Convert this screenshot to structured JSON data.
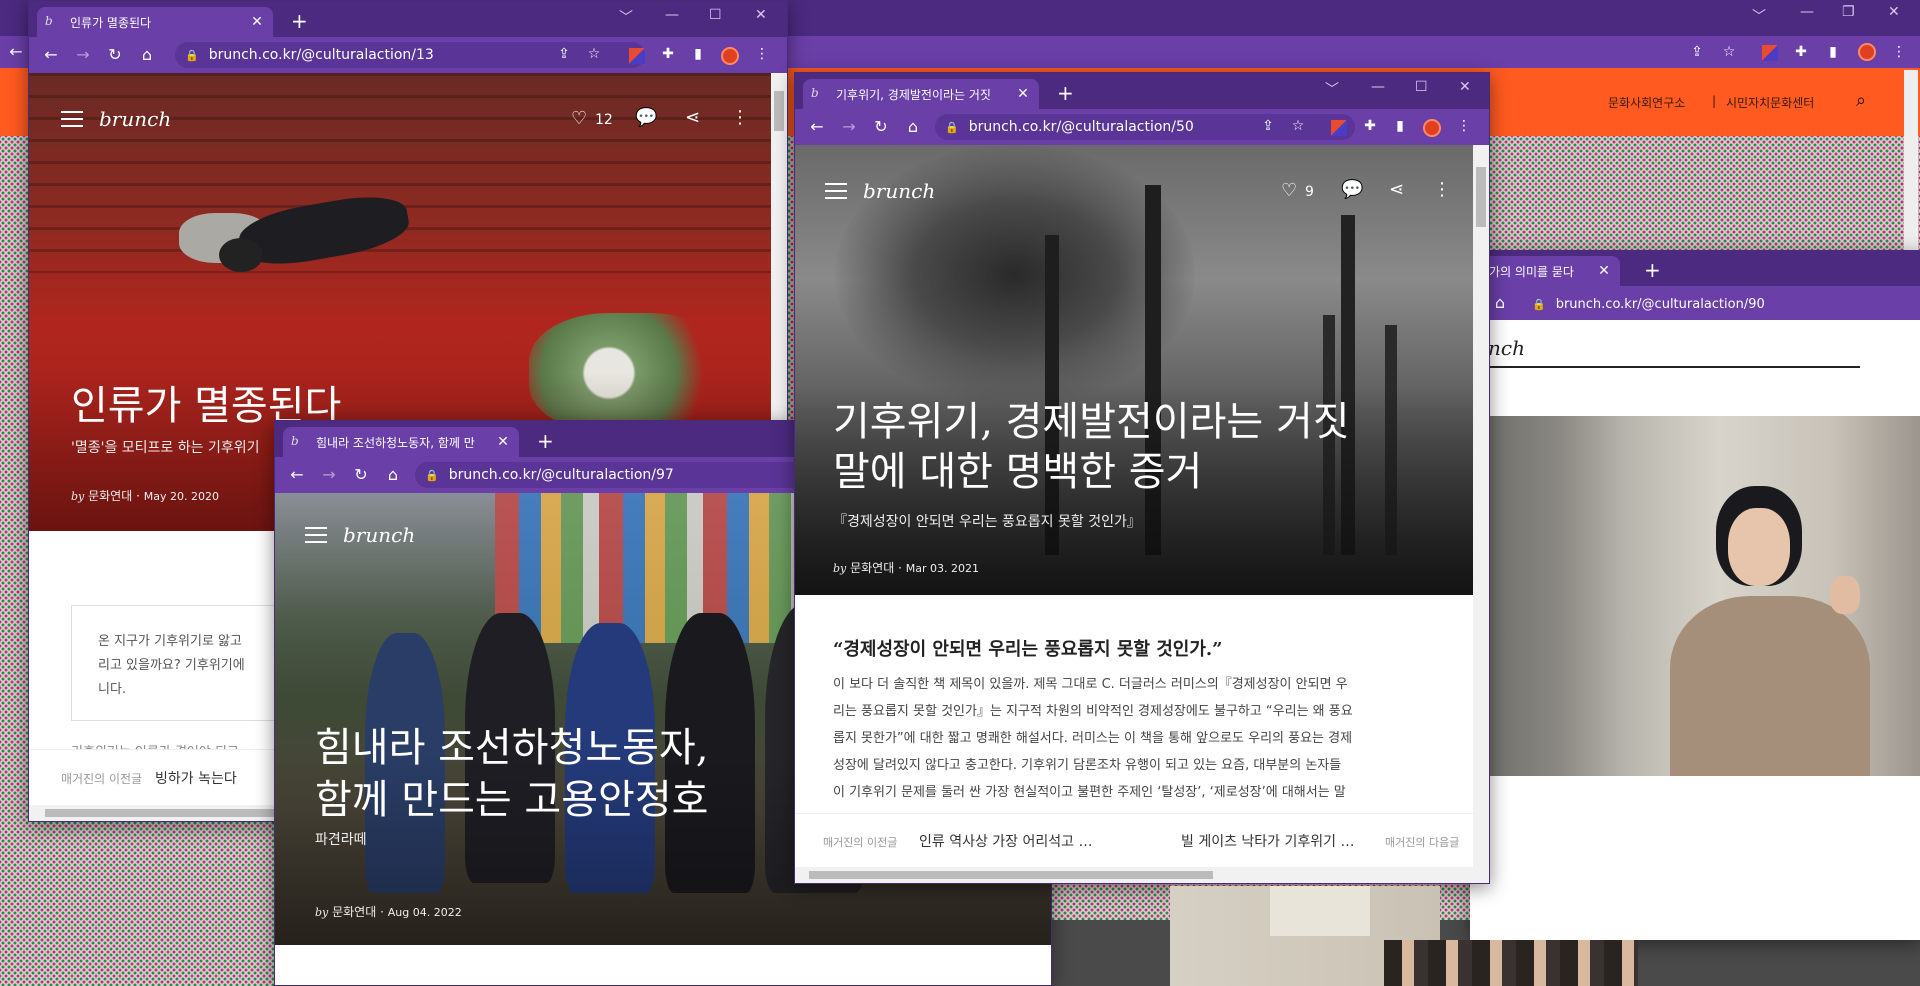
{
  "bg_window": {
    "header_links": [
      "문화사회연구소",
      "|",
      "시민자치문화센터"
    ],
    "search_icon": "search-icon"
  },
  "win_90": {
    "tab_title": "동가의 의미를 묻다",
    "url": "brunch.co.kr/@culturalaction/90",
    "logo": "nch"
  },
  "win_13": {
    "tab_title": "인류가 멸종된다",
    "url": "brunch.co.kr/@culturalaction/13",
    "logo": "brunch",
    "like_count": "12",
    "hero_title": "인류가 멸종된다",
    "subtitle": "'멸종'을 모티프로 하는 기후위기",
    "by": "by",
    "author": "문화연대",
    "date": "May 20. 2020",
    "quote": "온 지구가 기후위기로 앓고\n리고 있을까요? 기후위기에\n니다.",
    "body_fragment": "기후위기는 인류가 겪어야 되고",
    "prev_label": "매거진의 이전글",
    "prev_title": "빙하가 녹는다"
  },
  "win_97": {
    "tab_title": "힘내라 조선하청노동자, 함께 만",
    "url": "brunch.co.kr/@culturalaction/97",
    "logo": "brunch",
    "hero_title_1": "힘내라 조선하청노동자,",
    "hero_title_2": "함께 만드는 고용안정호",
    "subtitle": "파견라떼",
    "by": "by",
    "author": "문화연대",
    "date": "Aug 04. 2022"
  },
  "win_50": {
    "tab_title": "기후위기, 경제발전이라는 거짓",
    "url": "brunch.co.kr/@culturalaction/50",
    "logo": "brunch",
    "like_count": "9",
    "hero_title_1": "기후위기, 경제발전이라는 거짓",
    "hero_title_2": "말에 대한 명백한 증거",
    "subtitle": "『경제성장이 안되면 우리는 풍요롭지 못할 것인가』",
    "by": "by",
    "author": "문화연대",
    "date": "Mar 03. 2021",
    "article_heading": "“경제성장이 안되면 우리는 풍요롭지 못할 것인가.”",
    "article_lines": [
      "이 보다 더 솔직한 책 제목이 있을까. 제목 그대로 C. 더글러스 러미스의『경제성장이 안되면 우",
      "리는 풍요롭지 못할 것인가』는 지구적 차원의 비약적인 경제성장에도 불구하고 “우리는 왜 풍요",
      "롭지 못한가”에 대한 짧고 명쾌한 해설서다. 러미스는 이 책을 통해 앞으로도 우리의 풍요는 경제",
      "성장에 달려있지 않다고 충고한다. 기후위기 담론조차 유행이 되고 있는 요즘, 대부분의 논자들",
      "이 기후위기 문제를 둘러 싼 가장 현실적이고 불편한 주제인 ‘탈성장’, ‘제로성장’에 대해서는 말"
    ],
    "prev_label": "매거진의 이전글",
    "prev_title": "인류 역사상 가장 어리석고 …",
    "next_title": "빌 게이츠 낙타가 기후위기 …",
    "next_label": "매거진의 다음글"
  },
  "colors": {
    "chrome_dark": "#4b2a80",
    "chrome_tab": "#6a3fa8",
    "orange_header": "#ff5a1f"
  }
}
